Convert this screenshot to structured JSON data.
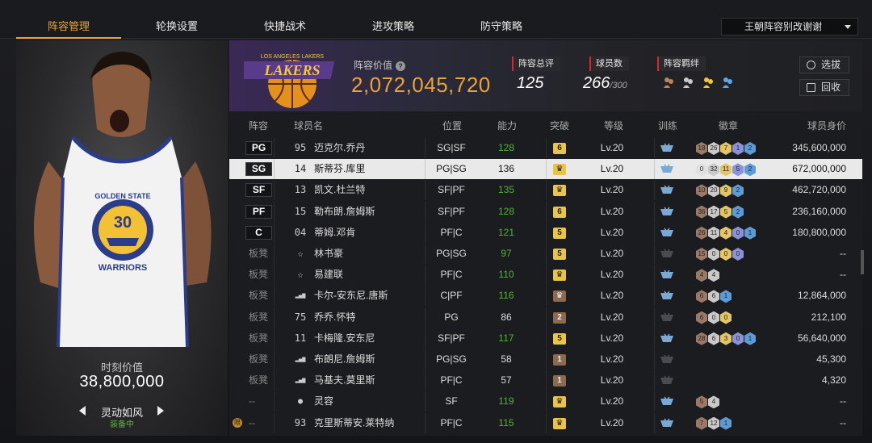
{
  "tabs": [
    "阵容管理",
    "轮换设置",
    "快捷战术",
    "进攻策略",
    "防守策略"
  ],
  "active_tab": 0,
  "lineup_select": "王朝阵容别改谢谢",
  "left_panel": {
    "jersey_team": "GOLDEN STATE",
    "jersey_number": "30",
    "jersey_name": "WARRIORS",
    "value_label": "时刻价值",
    "value": "38,800,000",
    "skill_name": "灵动如风",
    "skill_status": "装备中"
  },
  "header": {
    "team_logo_text": "LOS ANGELES LAKERS",
    "team_value_label": "阵容价值",
    "team_value": "2,072,045,720",
    "overall_label": "阵容总评",
    "overall_value": "125",
    "count_label": "球员数",
    "count_value": "266",
    "count_max": "/300",
    "bond_label": "阵容羁绊",
    "btn_pick": "选拔",
    "btn_recycle": "回收"
  },
  "columns": [
    "阵容",
    "球员名",
    "位置",
    "能力",
    "突破",
    "等级",
    "训练",
    "徽章",
    "球员身价"
  ],
  "colors": {
    "accent": "#e8a43a",
    "green": "#53b337",
    "gold": "#e9c44a",
    "brown": "#8b6a50"
  },
  "players": [
    {
      "lineup": "PG",
      "num": "95",
      "name": "迈克尔.乔丹",
      "pos": "SG|SF",
      "ability": "128",
      "green": true,
      "break": "6",
      "break_type": "gold",
      "level": "Lv.20",
      "train": "blue",
      "badges": [
        [
          "18",
          "#9a7a66"
        ],
        [
          "26",
          "#c9c9c9"
        ],
        [
          "7",
          "#e2c564"
        ],
        [
          "1",
          "#8b93d8"
        ],
        [
          "2",
          "#5d9bd6"
        ]
      ],
      "value": "345,600,000"
    },
    {
      "lineup": "SG",
      "num": "14",
      "name": "斯蒂芬.库里",
      "pos": "PG|SG",
      "ability": "136",
      "green": false,
      "break": "crown",
      "break_type": "gold",
      "level": "Lv.20",
      "train": "blue",
      "badges": [
        [
          "0",
          "#e0e0e0"
        ],
        [
          "32",
          "#c9c9c9"
        ],
        [
          "11",
          "#e2c564"
        ],
        [
          "5",
          "#8b93d8"
        ],
        [
          "2",
          "#5d9bd6"
        ]
      ],
      "value": "672,000,000",
      "selected": true
    },
    {
      "lineup": "SF",
      "num": "13",
      "name": "凯文.杜兰特",
      "pos": "SF|PF",
      "ability": "135",
      "green": true,
      "break": "crown",
      "break_type": "gold",
      "level": "Lv.20",
      "train": "blue",
      "badges": [
        [
          "10",
          "#9a7a66"
        ],
        [
          "20",
          "#c9c9c9"
        ],
        [
          "9",
          "#e2c564"
        ],
        [
          "2",
          "#5d9bd6"
        ]
      ],
      "value": "462,720,000"
    },
    {
      "lineup": "PF",
      "num": "15",
      "name": "勒布朗.詹姆斯",
      "pos": "SF|PF",
      "ability": "128",
      "green": true,
      "break": "6",
      "break_type": "gold",
      "level": "Lv.20",
      "train": "blue",
      "badges": [
        [
          "36",
          "#9a7a66"
        ],
        [
          "17",
          "#c9c9c9"
        ],
        [
          "5",
          "#e2c564"
        ],
        [
          "2",
          "#5d9bd6"
        ]
      ],
      "value": "236,160,000"
    },
    {
      "lineup": "C",
      "num": "04",
      "name": "蒂姆.邓肯",
      "pos": "PF|C",
      "ability": "121",
      "green": true,
      "break": "5",
      "break_type": "gold",
      "level": "Lv.20",
      "train": "blue",
      "badges": [
        [
          "26",
          "#9a7a66"
        ],
        [
          "11",
          "#c9c9c9"
        ],
        [
          "4",
          "#e2c564"
        ],
        [
          "0",
          "#8b93d8"
        ],
        [
          "1",
          "#5d9bd6"
        ]
      ],
      "value": "180,800,000"
    },
    {
      "lineup": "板凳",
      "num": "star",
      "name": "林书豪",
      "pos": "PG|SG",
      "ability": "97",
      "green": true,
      "break": "5",
      "break_type": "gold",
      "level": "Lv.20",
      "train": "gray",
      "badges": [
        [
          "15",
          "#9a7a66"
        ],
        [
          "0",
          "#c9c9c9"
        ],
        [
          "0",
          "#e2c564"
        ],
        [
          "0",
          "#8b93d8"
        ]
      ],
      "value": "--"
    },
    {
      "lineup": "板凳",
      "num": "star",
      "name": "易建联",
      "pos": "PF|C",
      "ability": "110",
      "green": true,
      "break": "crown",
      "break_type": "gold",
      "level": "Lv.20",
      "train": "blue",
      "badges": [
        [
          "4",
          "#9a7a66"
        ],
        [
          "4",
          "#c9c9c9"
        ]
      ],
      "value": "--"
    },
    {
      "lineup": "板凳",
      "num": "bars",
      "name": "卡尔-安东尼.唐斯",
      "pos": "C|PF",
      "ability": "116",
      "green": true,
      "break": "crown",
      "break_type": "brown",
      "level": "Lv.20",
      "train": "blue",
      "badges": [
        [
          "6",
          "#9a7a66"
        ],
        [
          "6",
          "#c9c9c9"
        ],
        [
          "1",
          "#5d9bd6"
        ]
      ],
      "value": "12,864,000"
    },
    {
      "lineup": "板凳",
      "num": "75",
      "name": "乔乔.怀特",
      "pos": "PG",
      "ability": "86",
      "green": false,
      "break": "2",
      "break_type": "brown",
      "level": "Lv.20",
      "train": "gray",
      "badges": [
        [
          "6",
          "#9a7a66"
        ],
        [
          "0",
          "#c9c9c9"
        ],
        [
          "0",
          "#e2c564"
        ]
      ],
      "value": "212,100"
    },
    {
      "lineup": "板凳",
      "num": "11",
      "name": "卡梅隆.安东尼",
      "pos": "SF|PF",
      "ability": "117",
      "green": true,
      "break": "5",
      "break_type": "gold",
      "level": "Lv.20",
      "train": "blue",
      "badges": [
        [
          "28",
          "#9a7a66"
        ],
        [
          "6",
          "#c9c9c9"
        ],
        [
          "3",
          "#e2c564"
        ],
        [
          "0",
          "#8b93d8"
        ],
        [
          "1",
          "#5d9bd6"
        ]
      ],
      "value": "56,640,000"
    },
    {
      "lineup": "板凳",
      "num": "bars",
      "name": "布朗尼.詹姆斯",
      "pos": "PG|SG",
      "ability": "58",
      "green": false,
      "break": "1",
      "break_type": "brown",
      "level": "Lv.20",
      "train": "gray",
      "badges": [],
      "value": "45,300"
    },
    {
      "lineup": "板凳",
      "num": "bars",
      "name": "马基夫.莫里斯",
      "pos": "PF|C",
      "ability": "57",
      "green": false,
      "break": "1",
      "break_type": "brown",
      "level": "Lv.20",
      "train": "gray",
      "badges": [],
      "value": "4,320"
    },
    {
      "lineup": "--",
      "num": "person",
      "name": "灵容",
      "pos": "SF",
      "ability": "119",
      "green": true,
      "break": "crown",
      "break_type": "gold",
      "level": "Lv.20",
      "train": "blue",
      "badges": [
        [
          "5",
          "#9a7a66"
        ],
        [
          "4",
          "#c9c9c9"
        ]
      ],
      "value": "--"
    },
    {
      "lineup": "--",
      "num": "93",
      "name": "克里斯蒂安.莱特纳",
      "pos": "PF|C",
      "ability": "115",
      "green": true,
      "break": "crown",
      "break_type": "gold",
      "level": "Lv.20",
      "train": "blue",
      "badges": [
        [
          "7",
          "#9a7a66"
        ],
        [
          "12",
          "#c9c9c9"
        ],
        [
          "1",
          "#5d9bd6"
        ]
      ],
      "value": "--",
      "limited": true
    }
  ],
  "limited_mark": "限"
}
